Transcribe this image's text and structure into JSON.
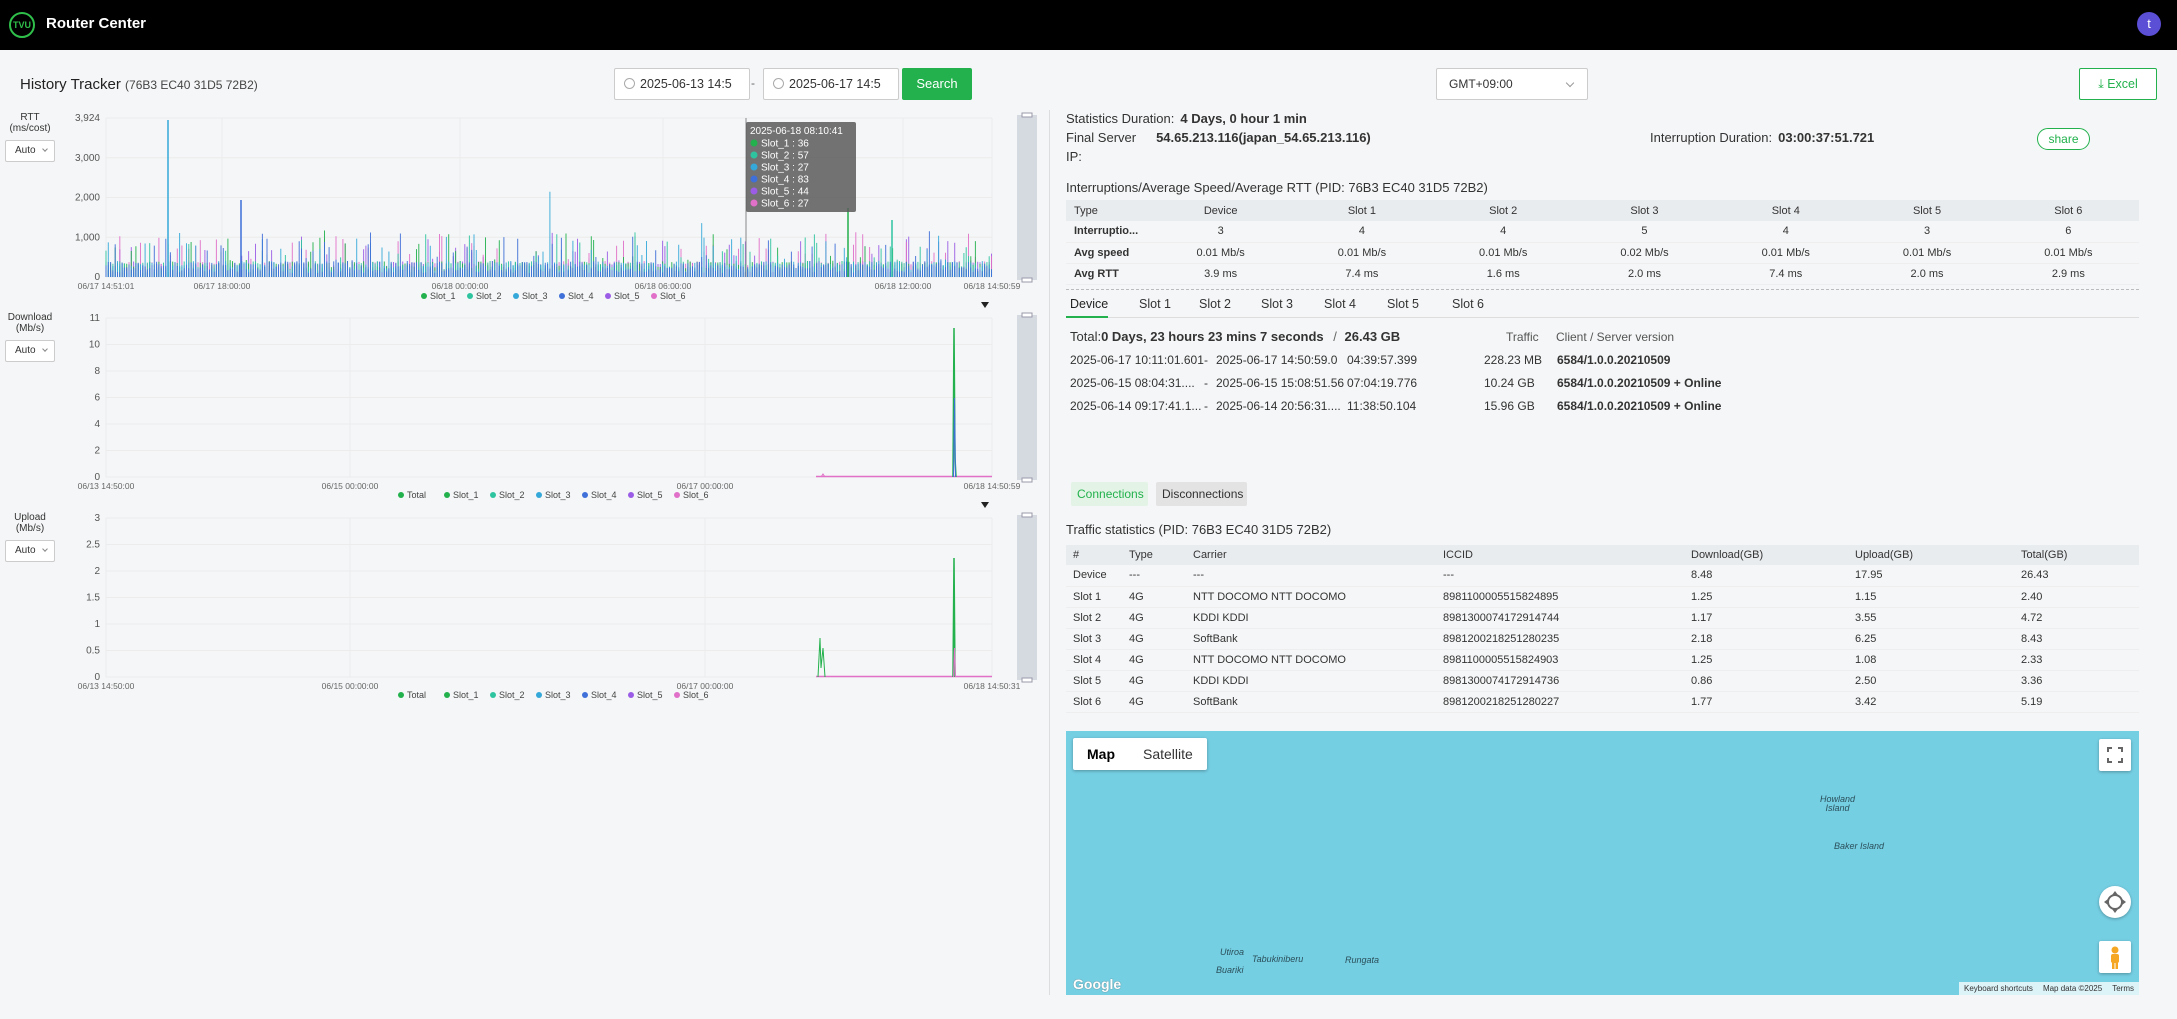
{
  "app": {
    "logo_text": "TVU",
    "title": "Router Center",
    "avatar_initial": "t"
  },
  "header": {
    "title": "History Tracker",
    "pid": "(76B3 EC40 31D5 72B2)",
    "start_date": "2025-06-13 14:5",
    "end_date": "2025-06-17 14:5",
    "date_separator": "-",
    "search_label": "Search",
    "timezone": "GMT+09:00",
    "excel_label": "⤓ Excel"
  },
  "colors": {
    "accent": "#22b14c",
    "slot1": "#22b14c",
    "slot2": "#2fc4a0",
    "slot3": "#34a8d8",
    "slot4": "#3f6fd8",
    "slot5": "#9b5de5",
    "slot6": "#e070c8",
    "total": "#22b14c"
  },
  "rtt_chart": {
    "ylabel": "RTT\n(ms/cost)",
    "scale_label": "Auto",
    "yticks": [
      "3,924",
      "3,000",
      "2,000",
      "1,000",
      "0"
    ],
    "xticks": [
      "06/17 14:51:01",
      "06/17 18:00:00",
      "06/18 00:00:00",
      "06/18 06:00:00",
      "06/18 12:00:00",
      "06/18 14:50:59"
    ],
    "legend": [
      "Slot_1",
      "Slot_2",
      "Slot_3",
      "Slot_4",
      "Slot_5",
      "Slot_6"
    ],
    "tooltip": {
      "time": "2025-06-18 08:10:41",
      "items": [
        "Slot_1 : 36",
        "Slot_2 : 57",
        "Slot_3 : 27",
        "Slot_4 : 83",
        "Slot_5 : 44",
        "Slot_6 : 27"
      ]
    }
  },
  "download_chart": {
    "ylabel": "Download\n(Mb/s)",
    "scale_label": "Auto",
    "yticks": [
      "11",
      "10",
      "8",
      "6",
      "4",
      "2",
      "0"
    ],
    "xticks": [
      "06/13 14:50:00",
      "06/15 00:00:00",
      "06/17 00:00:00",
      "06/18 14:50:59"
    ],
    "legend": [
      "Total",
      "Slot_1",
      "Slot_2",
      "Slot_3",
      "Slot_4",
      "Slot_5",
      "Slot_6"
    ]
  },
  "upload_chart": {
    "ylabel": "Upload\n(Mb/s)",
    "scale_label": "Auto",
    "yticks": [
      "3",
      "2.5",
      "2",
      "1.5",
      "1",
      "0.5",
      "0"
    ],
    "xticks": [
      "06/13 14:50:00",
      "06/15 00:00:00",
      "06/17 00:00:00",
      "06/18 14:50:31"
    ],
    "legend": [
      "Total",
      "Slot_1",
      "Slot_2",
      "Slot_3",
      "Slot_4",
      "Slot_5",
      "Slot_6"
    ]
  },
  "stats": {
    "duration_label": "Statistics Duration:",
    "duration_value": "4 Days, 0 hour 1 min",
    "server_label": "Final Server",
    "server_value": "54.65.213.116(japan_54.65.213.116)",
    "ip_label": "IP:",
    "interruption_label": "Interruption Duration:",
    "interruption_value": "03:00:37:51.721",
    "share_label": "share"
  },
  "int_table": {
    "title": "Interruptions/Average Speed/Average RTT",
    "pid": "(PID: 76B3 EC40 31D5 72B2)",
    "headers": [
      "Type",
      "Device",
      "Slot 1",
      "Slot 2",
      "Slot 3",
      "Slot 4",
      "Slot 5",
      "Slot 6"
    ],
    "rows": [
      [
        "Interruptio...",
        "3",
        "4",
        "4",
        "5",
        "4",
        "3",
        "6"
      ],
      [
        "Avg speed",
        "0.01 Mb/s",
        "0.01 Mb/s",
        "0.01 Mb/s",
        "0.02 Mb/s",
        "0.01 Mb/s",
        "0.01 Mb/s",
        "0.01 Mb/s"
      ],
      [
        "Avg RTT",
        "3.9 ms",
        "7.4 ms",
        "1.6 ms",
        "2.0 ms",
        "7.4 ms",
        "2.0 ms",
        "2.9 ms"
      ]
    ]
  },
  "tabs": [
    "Device",
    "Slot 1",
    "Slot 2",
    "Slot 3",
    "Slot 4",
    "Slot 5",
    "Slot 6"
  ],
  "sessions": {
    "total_label": "Total:",
    "total_time": "0 Days, 23 hours 23 mins 7 seconds",
    "total_sep": "/",
    "total_traffic": "26.43 GB",
    "traffic_header": "Traffic",
    "version_header": "Client / Server version",
    "rows": [
      {
        "start": "2025-06-17 10:11:01.601",
        "sep": "-",
        "end": "2025-06-17 14:50:59.0",
        "duration": "04:39:57.399",
        "traffic": "228.23 MB",
        "version": "6584/1.0.0.20210509"
      },
      {
        "start": "2025-06-15 08:04:31....",
        "sep": "-",
        "end": "2025-06-15 15:08:51.56",
        "duration": "07:04:19.776",
        "traffic": "10.24 GB",
        "version": "6584/1.0.0.20210509 + Online"
      },
      {
        "start": "2025-06-14 09:17:41.1...",
        "sep": "-",
        "end": "2025-06-14 20:56:31....",
        "duration": "11:38:50.104",
        "traffic": "15.96 GB",
        "version": "6584/1.0.0.20210509 + Online"
      }
    ]
  },
  "conn_buttons": {
    "connections": "Connections",
    "disconnections": "Disconnections"
  },
  "traffic": {
    "title": "Traffic statistics",
    "pid": "(PID: 76B3 EC40 31D5 72B2)",
    "headers": [
      "#",
      "Type",
      "Carrier",
      "ICCID",
      "Download(GB)",
      "Upload(GB)",
      "Total(GB)"
    ],
    "rows": [
      [
        "Device",
        "---",
        "---",
        "---",
        "8.48",
        "17.95",
        "26.43"
      ],
      [
        "Slot 1",
        "4G",
        "NTT DOCOMO NTT DOCOMO",
        "8981100005515824895",
        "1.25",
        "1.15",
        "2.40"
      ],
      [
        "Slot 2",
        "4G",
        "KDDI KDDI",
        "8981300074172914744",
        "1.17",
        "3.55",
        "4.72"
      ],
      [
        "Slot 3",
        "4G",
        "SoftBank",
        "8981200218251280235",
        "2.18",
        "6.25",
        "8.43"
      ],
      [
        "Slot 4",
        "4G",
        "NTT DOCOMO NTT DOCOMO",
        "8981100005515824903",
        "1.25",
        "1.08",
        "2.33"
      ],
      [
        "Slot 5",
        "4G",
        "KDDI KDDI",
        "8981300074172914736",
        "0.86",
        "2.50",
        "3.36"
      ],
      [
        "Slot 6",
        "4G",
        "SoftBank",
        "8981200218251280227",
        "1.77",
        "3.42",
        "5.19"
      ]
    ]
  },
  "map": {
    "map_label": "Map",
    "satellite_label": "Satellite",
    "places": [
      "Howland\nIsland",
      "Baker Island",
      "Utiroa",
      "Tabukiniberu",
      "Rungata",
      "Buariki"
    ],
    "google": "Google",
    "footer": [
      "Keyboard shortcuts",
      "Map data ©2025",
      "Terms"
    ]
  }
}
